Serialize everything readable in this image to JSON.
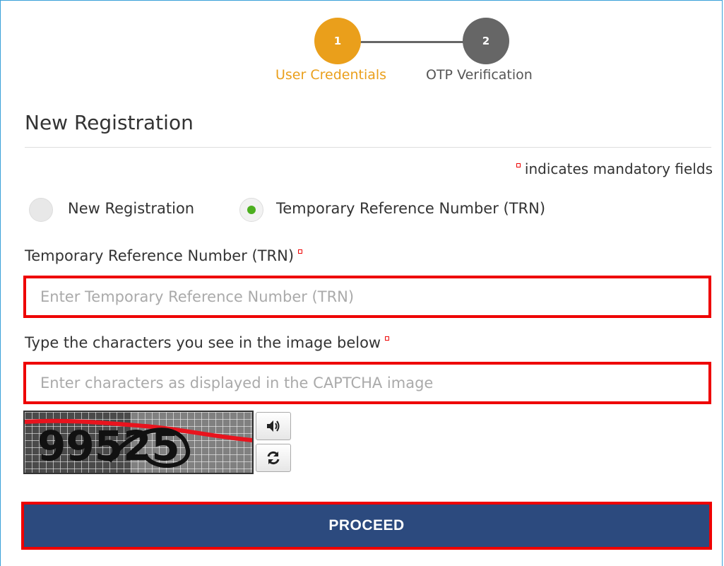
{
  "stepper": {
    "steps": [
      {
        "number": "1",
        "label": "User Credentials",
        "status": "active",
        "color": "#ea9f1b"
      },
      {
        "number": "2",
        "label": "OTP Verification",
        "status": "pending",
        "color": "#666666"
      }
    ]
  },
  "page_title": "New Registration",
  "mandatory_note": "indicates mandatory fields",
  "radio_options": [
    {
      "label": "New Registration",
      "selected": false
    },
    {
      "label": "Temporary Reference Number (TRN)",
      "selected": true
    }
  ],
  "trn_field": {
    "label": "Temporary Reference Number (TRN)",
    "placeholder": "Enter Temporary Reference Number (TRN)",
    "value": ""
  },
  "captcha_field": {
    "label": "Type the characters you see in the image below",
    "placeholder": "Enter characters as displayed in the CAPTCHA image",
    "value": ""
  },
  "captcha": {
    "image_text": "99525",
    "audio_icon": "speaker-icon",
    "refresh_icon": "refresh-icon"
  },
  "proceed_label": "PROCEED",
  "colors": {
    "accent": "#ea9f1b",
    "primary_button": "#2c4a7e",
    "error_border": "#ee0000",
    "selected_radio": "#4caf1f"
  }
}
